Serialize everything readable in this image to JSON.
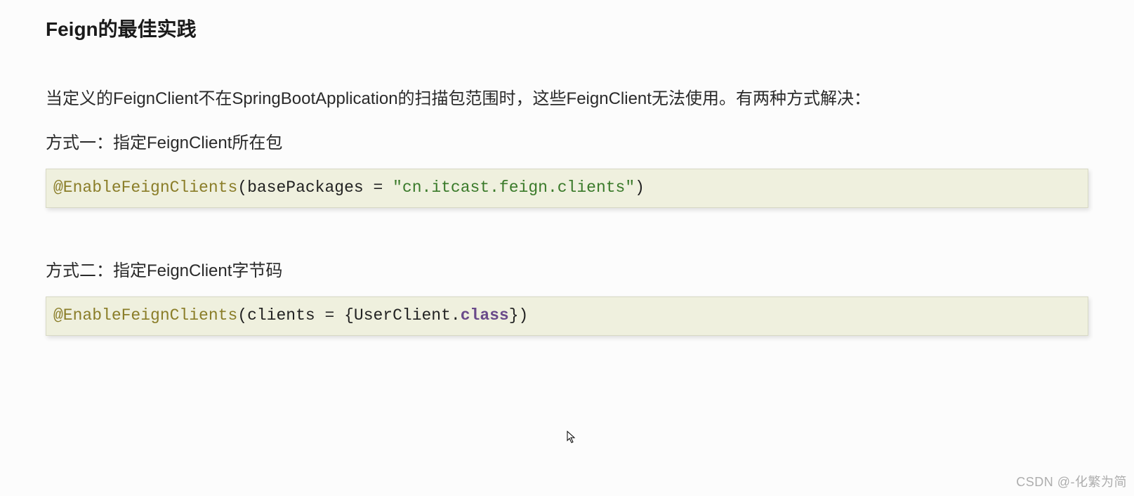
{
  "heading": "Feign的最佳实践",
  "intro": "当定义的FeignClient不在SpringBootApplication的扫描包范围时，这些FeignClient无法使用。有两种方式解决：",
  "method1": {
    "label": "方式一：指定FeignClient所在包",
    "code": {
      "annotation": "@EnableFeignClients",
      "open": "(",
      "param": "basePackages = ",
      "string": "\"cn.itcast.feign.clients\"",
      "close": ")"
    }
  },
  "method2": {
    "label": "方式二：指定FeignClient字节码",
    "code": {
      "annotation": "@EnableFeignClients",
      "open": "(",
      "param1": "clients = {UserClient.",
      "class_kw": "class",
      "param2": "}",
      "close": ")"
    }
  },
  "watermark": "CSDN @-化繁为简"
}
